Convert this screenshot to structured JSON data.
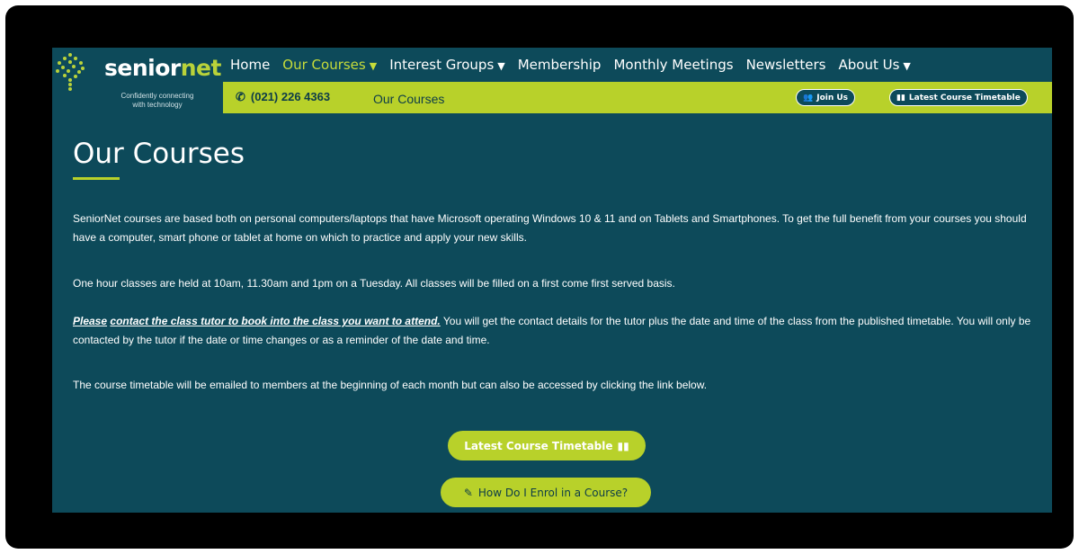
{
  "brand": {
    "name_main": "senior",
    "name_accent": "net",
    "tagline_line1": "Confidently connecting",
    "tagline_line2": "with technology",
    "accent_color": "#b8d12a",
    "background_color": "#0d4a5a"
  },
  "nav": {
    "items": [
      {
        "label": "Home",
        "dropdown": false
      },
      {
        "label": "Our Courses",
        "dropdown": true,
        "active": true
      },
      {
        "label": "Interest Groups",
        "dropdown": true
      },
      {
        "label": "Membership",
        "dropdown": false
      },
      {
        "label": "Monthly Meetings",
        "dropdown": false
      },
      {
        "label": "Newsletters",
        "dropdown": false
      },
      {
        "label": "About Us",
        "dropdown": true
      }
    ],
    "caret": "▼"
  },
  "subbar": {
    "phone_icon": "phone-icon",
    "phone": "(021) 226 4363",
    "breadcrumb": "Our Courses",
    "join_label": "Join Us",
    "join_icon": "users-icon",
    "timetable_label": "Latest Course Timetable",
    "timetable_icon": "book-icon"
  },
  "main": {
    "title": "Our Courses",
    "para1": "SeniorNet courses are based both on personal computers/laptops that have Microsoft operating Windows 10 & 11 and on Tablets and Smartphones.  To get the full benefit from your courses you should have a computer, smart phone or tablet at home on which to practice and apply your new skills.",
    "para2": "One hour classes are held at 10am, 11.30am and 1pm on a Tuesday.  All classes will be filled on a first come first served basis.",
    "para3_link1": "Please",
    "para3_link2": "contact the class tutor to book into the class you want to attend.",
    "para3_rest": "  You will get the contact details for the tutor plus the date and time of the class from the published timetable. You will only be contacted by the tutor if the date or time changes or as a reminder of the date and time.",
    "para4": "The course timetable will be emailed to members at the beginning of each month but can also be accessed by clicking the link below.",
    "button_timetable": "Latest Course Timetable",
    "button_timetable_icon": "book-icon",
    "button_enrol": "How Do I Enrol in a Course?",
    "button_enrol_icon": "pencil-icon"
  }
}
